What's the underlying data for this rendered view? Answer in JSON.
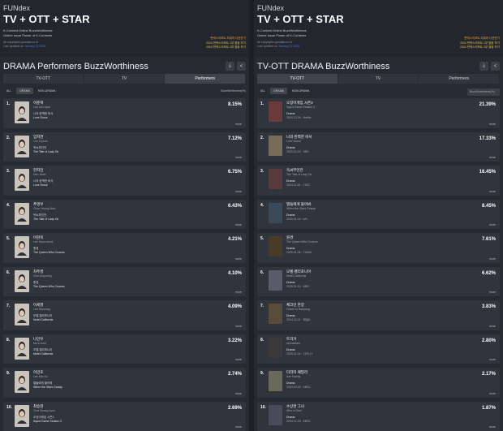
{
  "panels": [
    {
      "brand": "FUNdex",
      "headline": "TV + OTT + STAR",
      "sub1": "K-Content Online BuzzWorthiness",
      "sub2": "Online Issue Power of K-Contents",
      "meta1": "All copyrights goodata.co.kr",
      "meta2_prefix": "Last updated on ",
      "meta2_date": "January 21 2025",
      "link1": "펀덱스리포트 최대치 다운받기",
      "link2": "2024 펀덱스리포트 1부 열람 보기",
      "link3": "2024 펀덱스리포트 2부 열람 보기",
      "title": "DRAMA Performers BuzzWorthiness",
      "tabs": [
        "TV-OTT",
        "TV",
        "Performers"
      ],
      "active_tab": 2,
      "chips": [
        "ALL",
        "DRAMA",
        "NON-DRAMA"
      ],
      "metric": "BuzzWorthiness(%)",
      "rows": [
        {
          "rank": "1.",
          "name": "이준혁",
          "en": "Lee Jun-hyuk",
          "t1": "나의 완벽한 비서",
          "t2": "Love Scout",
          "pct": "8.15%",
          "more": "more"
        },
        {
          "rank": "2.",
          "name": "임지연",
          "en": "Lim Ji-yeon",
          "t1": "옥씨부인전",
          "t2": "The Tale of Lady Ok",
          "pct": "7.12%",
          "more": "more"
        },
        {
          "rank": "3.",
          "name": "한지민",
          "en": "Han Jimin",
          "t1": "나의 완벽한 비서",
          "t2": "Love Scout",
          "pct": "6.75%",
          "more": "more"
        },
        {
          "rank": "4.",
          "name": "추영우",
          "en": "Choo Young-Woo",
          "t1": "옥씨부인전",
          "t2": "The Tale of Lady Ok",
          "pct": "6.43%",
          "more": "more"
        },
        {
          "rank": "5.",
          "name": "이현욱",
          "en": "Lee Hyun-wook",
          "t1": "원경",
          "t2": "The Queen Who Crowns",
          "pct": "4.21%",
          "more": "more"
        },
        {
          "rank": "6.",
          "name": "차주영",
          "en": "Cha Jooyoung",
          "t1": "원경",
          "t2": "The Queen Who Crowns",
          "pct": "4.10%",
          "more": "more"
        },
        {
          "rank": "7.",
          "name": "이세영",
          "en": "Lee Seyoung",
          "t1": "모텔 캘리포니아",
          "t2": "Motel California",
          "pct": "4.09%",
          "more": "more"
        },
        {
          "rank": "8.",
          "name": "나인우",
          "en": "Na In-woo",
          "t1": "모텔 캘리포니아",
          "t2": "Motel California",
          "pct": "3.22%",
          "more": "more"
        },
        {
          "rank": "9.",
          "name": "이민호",
          "en": "Lee Min-ho",
          "t1": "별들에게 물어봐",
          "t2": "When the Stars Gossip",
          "pct": "2.74%",
          "more": "more"
        },
        {
          "rank": "10.",
          "name": "최승현",
          "en": "Choi Seung-hyun",
          "t1": "오징어게임 시즌2",
          "t2": "Squid Game Season 2",
          "pct": "2.69%",
          "more": "more"
        }
      ]
    },
    {
      "brand": "FUNdex",
      "headline": "TV + OTT + STAR",
      "sub1": "K-Content Online BuzzWorthiness",
      "sub2": "Online Issue Power of K-Contents",
      "meta1": "All copyrights goodata.co.kr",
      "meta2_prefix": "Last updated on ",
      "meta2_date": "January 21 2025",
      "link1": "펀덱스리포트 최대치 다운받기",
      "link2": "2024 펀덱스리포트 1부 열람 보기",
      "link3": "2024 펀덱스리포트 2부 열람 보기",
      "title": "TV-OTT DRAMA BuzzWorthiness",
      "tabs": [
        "TV-OTT",
        "TV",
        "Performers"
      ],
      "active_tab": 0,
      "chips": [
        "ALL",
        "DRAMA",
        "NON-DRAMA"
      ],
      "metric": "BuzzWorthiness(%)",
      "rows": [
        {
          "rank": "1.",
          "name": "오징어게임 시즌2",
          "en": "Squid Game Season 2",
          "genre": "Drama",
          "date": "2024.12.26 · Netflix",
          "pct": "21.39%",
          "more": "more"
        },
        {
          "rank": "2.",
          "name": "나의 완벽한 비서",
          "en": "Love Scout",
          "genre": "Drama",
          "date": "2025.01.03 · SBS",
          "pct": "17.33%",
          "more": "more"
        },
        {
          "rank": "3.",
          "name": "옥씨부인전",
          "en": "The Tale of Lady Ok",
          "genre": "Drama",
          "date": "2024.11.30 · JTBC",
          "pct": "16.45%",
          "more": "more"
        },
        {
          "rank": "4.",
          "name": "별들에게 물어봐",
          "en": "When the Stars Gossip",
          "genre": "Drama",
          "date": "2025.01.04 · tvN",
          "pct": "8.45%",
          "more": "more"
        },
        {
          "rank": "5.",
          "name": "원경",
          "en": "The Queen Who Crowns",
          "genre": "Drama",
          "date": "2025.01.06 · TVING",
          "pct": "7.61%",
          "more": "more"
        },
        {
          "rank": "6.",
          "name": "모텔 캘리포니아",
          "en": "Motel California",
          "genre": "Drama",
          "date": "2025.01.10 · MBC",
          "pct": "6.62%",
          "more": "more"
        },
        {
          "rank": "7.",
          "name": "체크인 한양",
          "en": "Check In Hanyang",
          "genre": "Drama",
          "date": "2024.12.21 · 채널A",
          "pct": "3.83%",
          "more": "more"
        },
        {
          "rank": "8.",
          "name": "트리거",
          "en": "Unmasked",
          "genre": "Drama",
          "date": "2025.01.15 · 디즈니+",
          "pct": "2.80%",
          "more": "more"
        },
        {
          "rank": "9.",
          "name": "다리미 패밀리",
          "en": "Iron Family",
          "genre": "Drama",
          "date": "2024.09.28 · KBS2",
          "pct": "2.17%",
          "more": "more"
        },
        {
          "rank": "10.",
          "name": "수상한 그녀",
          "en": "Who is She!",
          "genre": "Drama",
          "date": "2024.12.18 · KBS2",
          "pct": "1.87%",
          "more": "more"
        }
      ]
    }
  ],
  "icons": {
    "download": "download-icon",
    "share": "share-icon"
  }
}
